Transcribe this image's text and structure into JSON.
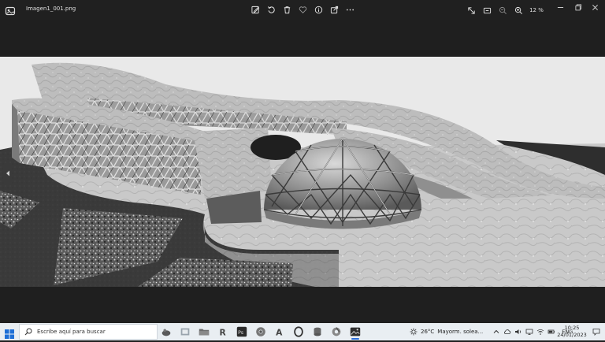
{
  "titlebar": {
    "file_name": "Imagen1_001.png",
    "zoom_level": "12 %"
  },
  "taskbar": {
    "search_placeholder": "Escribe aquí para buscar",
    "weather_temp": "26°C",
    "weather_desc": "Mayorm. solea...",
    "language": "ENG",
    "time": "10:25",
    "date": "24/01/2023"
  },
  "icons": [
    "photos-app-icon",
    "edit-icon",
    "rotate-icon",
    "delete-icon",
    "favorite-icon",
    "info-icon",
    "share-icon",
    "more-icon",
    "fullscreen-icon",
    "slideshow-icon",
    "zoom-out-icon",
    "zoom-in-icon",
    "minimize-icon",
    "maximize-icon",
    "close-icon",
    "previous-icon",
    "start-icon",
    "search-icon"
  ],
  "colors": {
    "titlebar_bg": "#202020",
    "taskbar_bg": "#e9eef2",
    "accent": "#2a6cd8"
  }
}
